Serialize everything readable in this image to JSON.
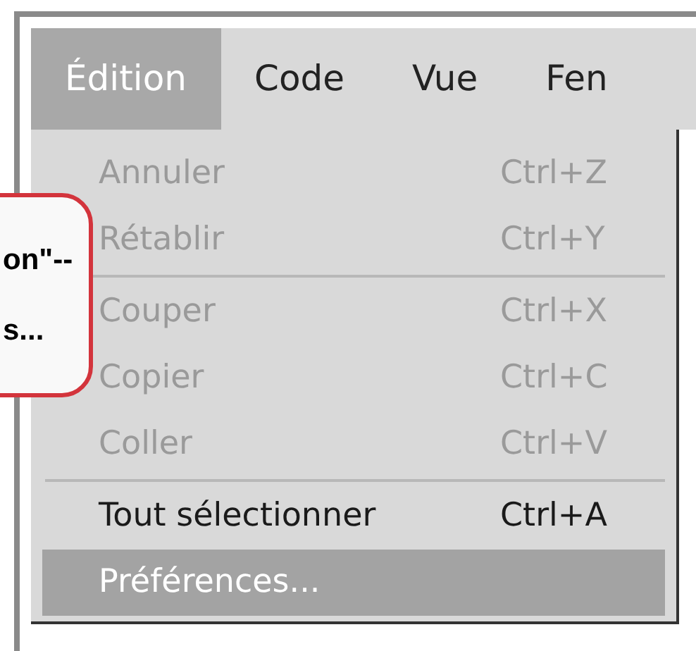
{
  "menu_bar": [
    {
      "label": "Édition",
      "selected": true
    },
    {
      "label": "Code",
      "selected": false
    },
    {
      "label": "Vue",
      "selected": false
    },
    {
      "label": "Fen",
      "selected": false
    }
  ],
  "dropdown": {
    "items": [
      {
        "kind": "item",
        "label": "Annuler",
        "shortcut": "Ctrl+Z",
        "disabled": true,
        "selected": false
      },
      {
        "kind": "item",
        "label": "Rétablir",
        "shortcut": "Ctrl+Y",
        "disabled": true,
        "selected": false
      },
      {
        "kind": "separator"
      },
      {
        "kind": "item",
        "label": "Couper",
        "shortcut": "Ctrl+X",
        "disabled": true,
        "selected": false
      },
      {
        "kind": "item",
        "label": "Copier",
        "shortcut": "Ctrl+C",
        "disabled": true,
        "selected": false
      },
      {
        "kind": "item",
        "label": "Coller",
        "shortcut": "Ctrl+V",
        "disabled": true,
        "selected": false
      },
      {
        "kind": "separator"
      },
      {
        "kind": "item",
        "label": "Tout sélectionner",
        "shortcut": "Ctrl+A",
        "disabled": false,
        "selected": false
      },
      {
        "kind": "item",
        "label": "Préférences...",
        "disabled": false,
        "selected": true
      }
    ]
  },
  "callout": {
    "lines": [
      "on\"--",
      "s..."
    ]
  }
}
